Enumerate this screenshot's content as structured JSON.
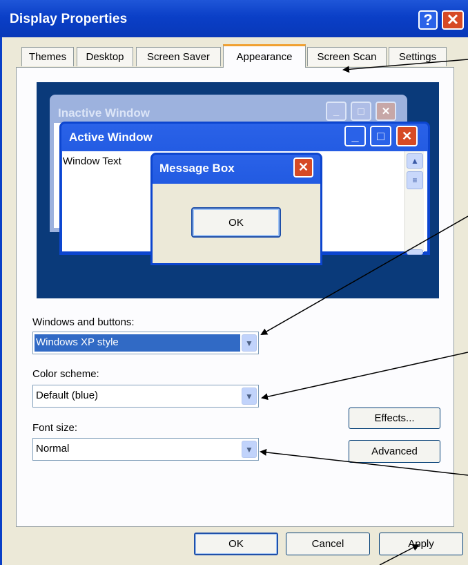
{
  "window": {
    "title": "Display Properties",
    "help_glyph": "?",
    "close_glyph": "✕"
  },
  "tabs": [
    {
      "label": "Themes"
    },
    {
      "label": "Desktop"
    },
    {
      "label": "Screen Saver"
    },
    {
      "label": "Appearance",
      "active": true
    },
    {
      "label": "Screen Scan"
    },
    {
      "label": "Settings"
    }
  ],
  "preview": {
    "inactive_title": "Inactive Window",
    "active_title": "Active Window",
    "window_text": "Window Text",
    "message_box_title": "Message Box",
    "message_ok": "OK"
  },
  "appearance": {
    "windows_buttons_label": "Windows and buttons:",
    "windows_buttons_value": "Windows XP style",
    "color_scheme_label": "Color scheme:",
    "color_scheme_value": "Default (blue)",
    "font_size_label": "Font size:",
    "font_size_value": "Normal",
    "effects_label": "Effects...",
    "advanced_label": "Advanced"
  },
  "footer": {
    "ok_label": "OK",
    "cancel_label": "Cancel",
    "apply_label": "Apply"
  },
  "colors": {
    "titlebar": "#0a3fc7",
    "dialog_bg": "#ece9d8",
    "close_red": "#d64a25",
    "selection": "#316ac5"
  },
  "icons": [
    "question-icon",
    "close-icon",
    "minimize-icon",
    "maximize-icon",
    "chevron-down-icon",
    "chevron-up-icon"
  ]
}
